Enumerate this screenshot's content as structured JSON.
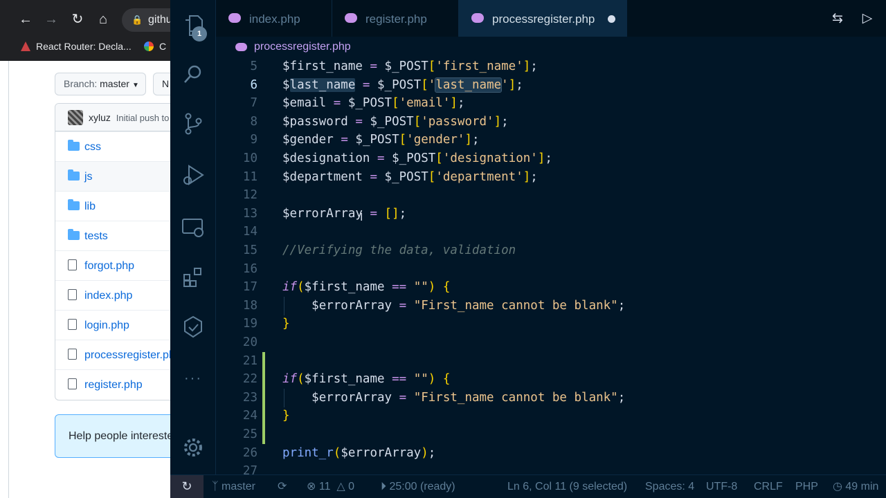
{
  "browser": {
    "address_text": "githu",
    "bookmarks": [
      {
        "label": "React Router: Decla...",
        "icon": "react-router-icon"
      },
      {
        "label": "C",
        "icon": "google-icon"
      }
    ]
  },
  "github": {
    "branch_prefix": "Branch:",
    "branch_name": "master",
    "other_button": "N",
    "commit_author": "xyluz",
    "commit_message": "Initial push to",
    "files": [
      {
        "name": "css",
        "type": "folder"
      },
      {
        "name": "js",
        "type": "folder"
      },
      {
        "name": "lib",
        "type": "folder"
      },
      {
        "name": "tests",
        "type": "folder"
      },
      {
        "name": "forgot.php",
        "type": "file"
      },
      {
        "name": "index.php",
        "type": "file"
      },
      {
        "name": "login.php",
        "type": "file"
      },
      {
        "name": "processregister.php",
        "type": "file"
      },
      {
        "name": "register.php",
        "type": "file"
      }
    ],
    "help_text": "Help people interested"
  },
  "vscode": {
    "explorer_badge": "1",
    "tabs": [
      {
        "label": "index.php",
        "active": false
      },
      {
        "label": "register.php",
        "active": false
      },
      {
        "label": "processregister.php",
        "active": true,
        "dirty": true
      }
    ],
    "breadcrumb": "processregister.php",
    "line_numbers": [
      "5",
      "6",
      "7",
      "8",
      "9",
      "10",
      "11",
      "12",
      "13",
      "14",
      "15",
      "16",
      "17",
      "18",
      "19",
      "20",
      "21",
      "22",
      "23",
      "24",
      "25",
      "26",
      "27"
    ],
    "current_line": "6",
    "modified_lines": [
      "21",
      "22",
      "23",
      "24",
      "25"
    ],
    "status": {
      "branch": "master",
      "errors": "11",
      "warnings": "0",
      "timer": "25:00 (ready)",
      "cursor": "Ln 6, Col 11 (9 selected)",
      "spaces": "Spaces: 4",
      "encoding": "UTF-8",
      "eol": "CRLF",
      "language": "PHP",
      "time_ago": "49 min"
    }
  },
  "colors": {
    "editor_bg": "#011627",
    "keyword": "#c792ea",
    "string": "#ecc48d",
    "bracket": "#ffd700",
    "comment": "#637777",
    "modified_gutter": "#9ccc65"
  }
}
